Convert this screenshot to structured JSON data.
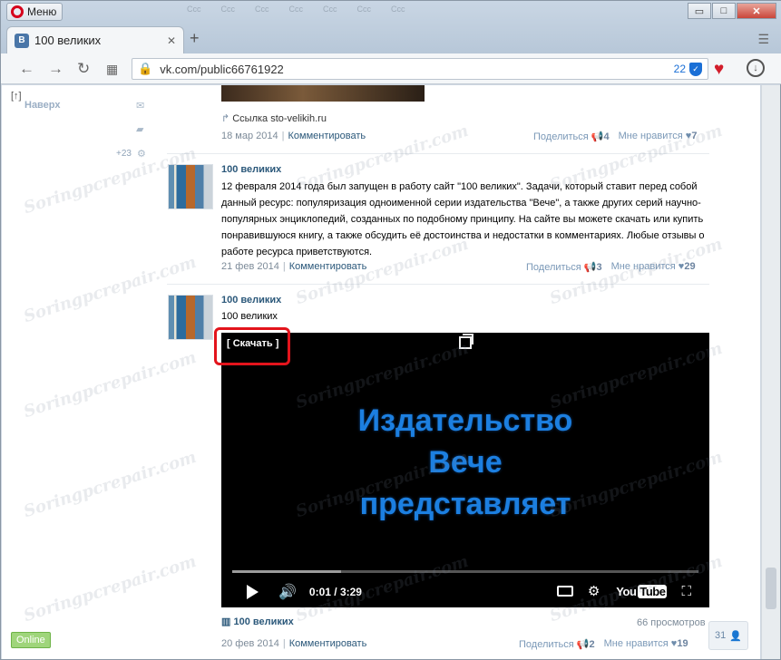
{
  "browser": {
    "menu_label": "Меню",
    "tab_title": "100 великих",
    "tab_favicon": "В",
    "faded_tabs": [
      "Ccc",
      "Ccc",
      "Ccc",
      "Ccc",
      "Ccc",
      "Ccc",
      "Ccc"
    ],
    "url": "vk.com/public66761922",
    "adblock_count": "22",
    "controls": {
      "minimize": "▭",
      "maximize": "□",
      "close": "✕"
    }
  },
  "sidebar": {
    "bracket": "[↑]",
    "up_label": "Наверх",
    "count": "+23",
    "online": "Online"
  },
  "posts": [
    {
      "link_text": "Ссылка sto-velikih.ru",
      "date": "18 мар 2014",
      "comment": "Комментировать",
      "share": "Поделиться",
      "share_count": "4",
      "like": "Мне нравится",
      "like_count": "7"
    },
    {
      "author": "100 великих",
      "text": "12 февраля 2014 года был запущен в работу сайт \"100 великих\". Задачи, который ставит перед собой данный ресурс: популяризация одноименной серии издательства \"Вече\", а также других серий научно-популярных энциклопедий, созданных по подобному принципу. На сайте вы можете скачать или купить понравившуюся книгу, а также обсудить её достоинства и недостатки в комментариях. Любые отзывы о работе ресурса приветствуются.",
      "date": "21 фев 2014",
      "comment": "Комментировать",
      "share": "Поделиться",
      "share_count": "3",
      "like": "Мне нравится",
      "like_count": "29"
    },
    {
      "author": "100 великих",
      "text": "100 великих",
      "video": {
        "download": "[ Скачать ]",
        "title_line1": "Издательство",
        "title_line2": "Вече",
        "title_line3": "представляет",
        "time": "0:01 / 3:29",
        "youtube_you": "You",
        "youtube_tube": "Tube"
      },
      "footer_title": "100 великих",
      "views": "66 просмотров",
      "date": "20 фев 2014",
      "comment": "Комментировать",
      "share": "Поделиться",
      "share_count": "2",
      "like": "Мне нравится",
      "like_count": "19"
    }
  ],
  "friends_count": "31",
  "watermark": "Soringpcrepair.com",
  "colors": {
    "link": "#2b587a",
    "accent": "#4a76a8",
    "highlight": "#e3141c",
    "video_title": "#1c7fe0"
  }
}
